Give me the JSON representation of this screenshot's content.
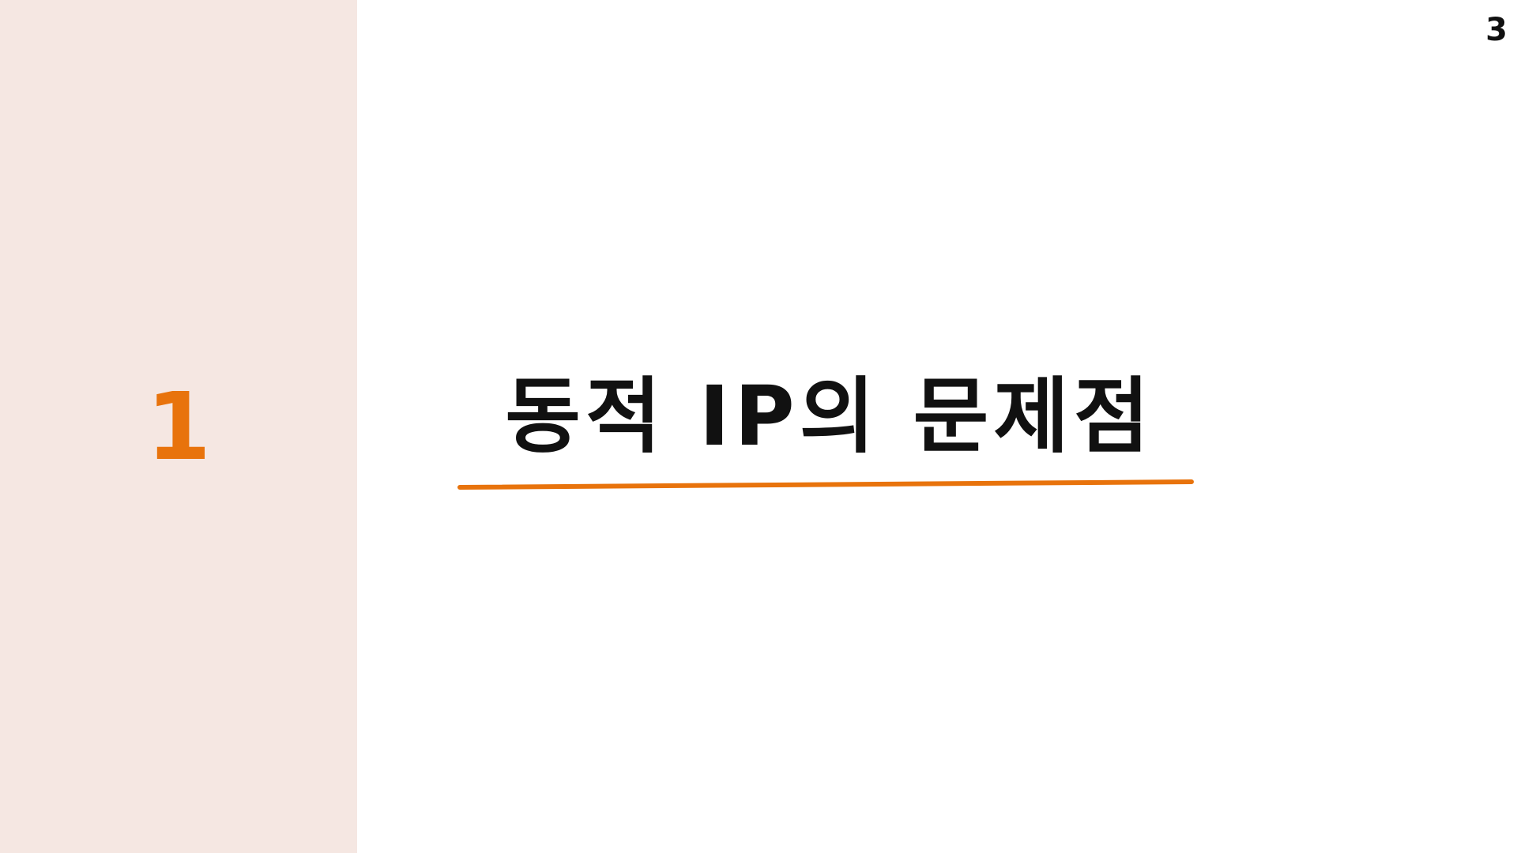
{
  "slide": {
    "page_number": "3",
    "section_number": "1",
    "title": "동적 IP의 문제점"
  },
  "colors": {
    "side_panel": "#f5e7e2",
    "accent": "#e8730c",
    "text": "#111111",
    "background": "#ffffff"
  }
}
